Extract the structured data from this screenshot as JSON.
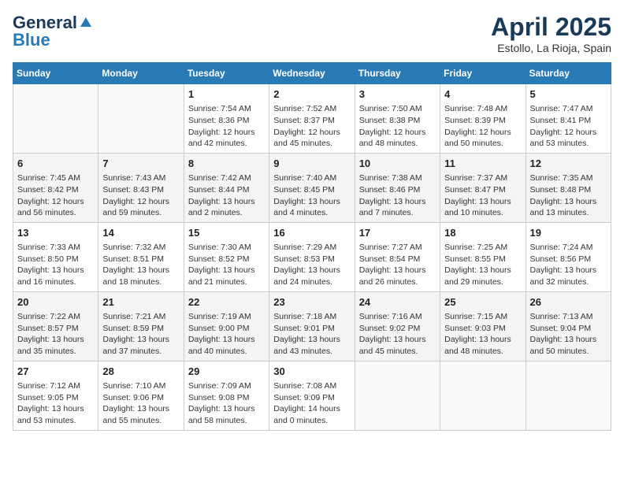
{
  "header": {
    "logo_general": "General",
    "logo_blue": "Blue",
    "month_title": "April 2025",
    "location": "Estollo, La Rioja, Spain"
  },
  "weekdays": [
    "Sunday",
    "Monday",
    "Tuesday",
    "Wednesday",
    "Thursday",
    "Friday",
    "Saturday"
  ],
  "weeks": [
    [
      {
        "day": "",
        "info": ""
      },
      {
        "day": "",
        "info": ""
      },
      {
        "day": "1",
        "info": "Sunrise: 7:54 AM\nSunset: 8:36 PM\nDaylight: 12 hours and 42 minutes."
      },
      {
        "day": "2",
        "info": "Sunrise: 7:52 AM\nSunset: 8:37 PM\nDaylight: 12 hours and 45 minutes."
      },
      {
        "day": "3",
        "info": "Sunrise: 7:50 AM\nSunset: 8:38 PM\nDaylight: 12 hours and 48 minutes."
      },
      {
        "day": "4",
        "info": "Sunrise: 7:48 AM\nSunset: 8:39 PM\nDaylight: 12 hours and 50 minutes."
      },
      {
        "day": "5",
        "info": "Sunrise: 7:47 AM\nSunset: 8:41 PM\nDaylight: 12 hours and 53 minutes."
      }
    ],
    [
      {
        "day": "6",
        "info": "Sunrise: 7:45 AM\nSunset: 8:42 PM\nDaylight: 12 hours and 56 minutes."
      },
      {
        "day": "7",
        "info": "Sunrise: 7:43 AM\nSunset: 8:43 PM\nDaylight: 12 hours and 59 minutes."
      },
      {
        "day": "8",
        "info": "Sunrise: 7:42 AM\nSunset: 8:44 PM\nDaylight: 13 hours and 2 minutes."
      },
      {
        "day": "9",
        "info": "Sunrise: 7:40 AM\nSunset: 8:45 PM\nDaylight: 13 hours and 4 minutes."
      },
      {
        "day": "10",
        "info": "Sunrise: 7:38 AM\nSunset: 8:46 PM\nDaylight: 13 hours and 7 minutes."
      },
      {
        "day": "11",
        "info": "Sunrise: 7:37 AM\nSunset: 8:47 PM\nDaylight: 13 hours and 10 minutes."
      },
      {
        "day": "12",
        "info": "Sunrise: 7:35 AM\nSunset: 8:48 PM\nDaylight: 13 hours and 13 minutes."
      }
    ],
    [
      {
        "day": "13",
        "info": "Sunrise: 7:33 AM\nSunset: 8:50 PM\nDaylight: 13 hours and 16 minutes."
      },
      {
        "day": "14",
        "info": "Sunrise: 7:32 AM\nSunset: 8:51 PM\nDaylight: 13 hours and 18 minutes."
      },
      {
        "day": "15",
        "info": "Sunrise: 7:30 AM\nSunset: 8:52 PM\nDaylight: 13 hours and 21 minutes."
      },
      {
        "day": "16",
        "info": "Sunrise: 7:29 AM\nSunset: 8:53 PM\nDaylight: 13 hours and 24 minutes."
      },
      {
        "day": "17",
        "info": "Sunrise: 7:27 AM\nSunset: 8:54 PM\nDaylight: 13 hours and 26 minutes."
      },
      {
        "day": "18",
        "info": "Sunrise: 7:25 AM\nSunset: 8:55 PM\nDaylight: 13 hours and 29 minutes."
      },
      {
        "day": "19",
        "info": "Sunrise: 7:24 AM\nSunset: 8:56 PM\nDaylight: 13 hours and 32 minutes."
      }
    ],
    [
      {
        "day": "20",
        "info": "Sunrise: 7:22 AM\nSunset: 8:57 PM\nDaylight: 13 hours and 35 minutes."
      },
      {
        "day": "21",
        "info": "Sunrise: 7:21 AM\nSunset: 8:59 PM\nDaylight: 13 hours and 37 minutes."
      },
      {
        "day": "22",
        "info": "Sunrise: 7:19 AM\nSunset: 9:00 PM\nDaylight: 13 hours and 40 minutes."
      },
      {
        "day": "23",
        "info": "Sunrise: 7:18 AM\nSunset: 9:01 PM\nDaylight: 13 hours and 43 minutes."
      },
      {
        "day": "24",
        "info": "Sunrise: 7:16 AM\nSunset: 9:02 PM\nDaylight: 13 hours and 45 minutes."
      },
      {
        "day": "25",
        "info": "Sunrise: 7:15 AM\nSunset: 9:03 PM\nDaylight: 13 hours and 48 minutes."
      },
      {
        "day": "26",
        "info": "Sunrise: 7:13 AM\nSunset: 9:04 PM\nDaylight: 13 hours and 50 minutes."
      }
    ],
    [
      {
        "day": "27",
        "info": "Sunrise: 7:12 AM\nSunset: 9:05 PM\nDaylight: 13 hours and 53 minutes."
      },
      {
        "day": "28",
        "info": "Sunrise: 7:10 AM\nSunset: 9:06 PM\nDaylight: 13 hours and 55 minutes."
      },
      {
        "day": "29",
        "info": "Sunrise: 7:09 AM\nSunset: 9:08 PM\nDaylight: 13 hours and 58 minutes."
      },
      {
        "day": "30",
        "info": "Sunrise: 7:08 AM\nSunset: 9:09 PM\nDaylight: 14 hours and 0 minutes."
      },
      {
        "day": "",
        "info": ""
      },
      {
        "day": "",
        "info": ""
      },
      {
        "day": "",
        "info": ""
      }
    ]
  ]
}
